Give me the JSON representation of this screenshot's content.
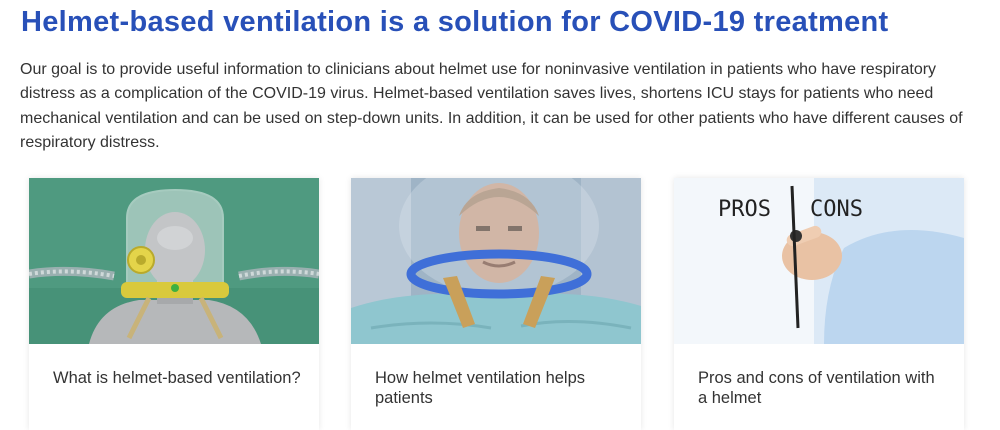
{
  "header": {
    "title": "Helmet-based ventilation is a solution for COVID-19 treatment"
  },
  "intro": {
    "text": "Our goal is to provide useful information to clinicians about helmet use for noninvasive ventilation in patients who have respiratory distress as a complication of the COVID-19 virus. Helmet-based ventilation saves lives, shortens ICU stays for patients who need mechanical ventilation and can be used on step-down units. In addition, it can be used for other patients who have different causes of respiratory distress."
  },
  "cards": [
    {
      "title": "What is helmet-based ventilation?",
      "image": "mannequin-helmet-photo"
    },
    {
      "title": "How helmet ventilation helps patients",
      "image": "patient-helmet-photo"
    },
    {
      "title": "Pros and cons of ventilation with a helmet",
      "image": "pros-cons-writing-photo",
      "image_text": {
        "left": "PROS",
        "right": "CONS"
      }
    }
  ],
  "colors": {
    "title": "#2850b8",
    "text": "#333333",
    "card1_bg": "#4f9a80",
    "card2_bg": "#9fb4c6",
    "card3_bg": "#dce9f6",
    "helmet_ring": "#3f6fd8"
  }
}
